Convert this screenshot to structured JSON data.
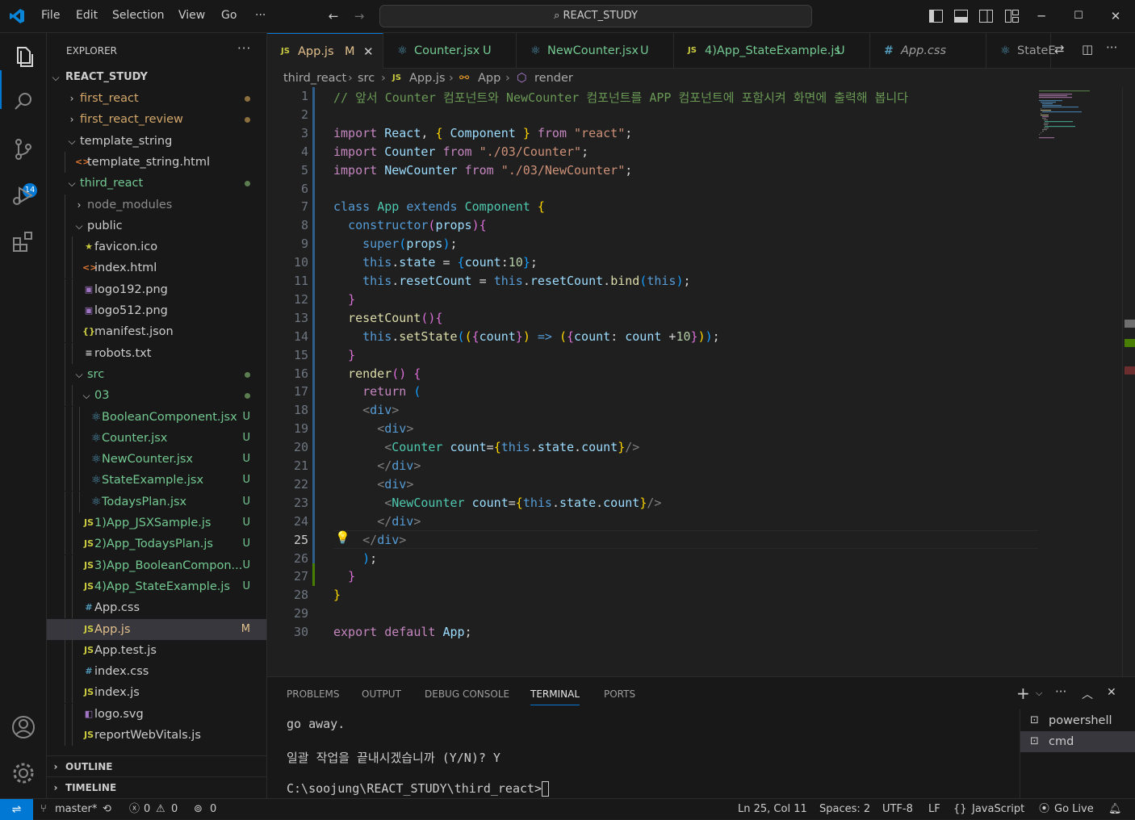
{
  "titlebar": {
    "menus": [
      "File",
      "Edit",
      "Selection",
      "View",
      "Go",
      "···"
    ],
    "search": "REACT_STUDY"
  },
  "activity": {
    "scm_badge": "14"
  },
  "explorer": {
    "title": "EXPLORER",
    "root": "REACT_STUDY",
    "items": [
      {
        "label": "first_react",
        "type": "folder",
        "open": false,
        "indent": 1,
        "color": "#d4a86a",
        "mark": "dot"
      },
      {
        "label": "first_react_review",
        "type": "folder",
        "open": false,
        "indent": 1,
        "color": "#d4a86a",
        "mark": "dot"
      },
      {
        "label": "template_string",
        "type": "folder",
        "open": true,
        "indent": 1,
        "color": "#cccccc",
        "mark": ""
      },
      {
        "label": "template_string.html",
        "type": "html",
        "indent": 2,
        "color": "#cccccc",
        "mark": ""
      },
      {
        "label": "third_react",
        "type": "folder",
        "open": true,
        "indent": 1,
        "color": "#73c991",
        "mark": "dotg"
      },
      {
        "label": "node_modules",
        "type": "folder",
        "open": false,
        "indent": 2,
        "color": "#8c8c8c",
        "mark": ""
      },
      {
        "label": "public",
        "type": "folder",
        "open": true,
        "indent": 2,
        "color": "#cccccc",
        "mark": ""
      },
      {
        "label": "favicon.ico",
        "type": "star",
        "indent": 3,
        "color": "#cccccc",
        "mark": ""
      },
      {
        "label": "index.html",
        "type": "html",
        "indent": 3,
        "color": "#cccccc",
        "mark": ""
      },
      {
        "label": "logo192.png",
        "type": "img",
        "indent": 3,
        "color": "#cccccc",
        "mark": ""
      },
      {
        "label": "logo512.png",
        "type": "img",
        "indent": 3,
        "color": "#cccccc",
        "mark": ""
      },
      {
        "label": "manifest.json",
        "type": "json",
        "indent": 3,
        "color": "#cccccc",
        "mark": ""
      },
      {
        "label": "robots.txt",
        "type": "txt",
        "indent": 3,
        "color": "#cccccc",
        "mark": ""
      },
      {
        "label": "src",
        "type": "folder",
        "open": true,
        "indent": 2,
        "color": "#73c991",
        "mark": "dotg"
      },
      {
        "label": "03",
        "type": "folder",
        "open": true,
        "indent": 3,
        "color": "#73c991",
        "mark": "dotg"
      },
      {
        "label": "BooleanComponent.jsx",
        "type": "react",
        "indent": 4,
        "color": "#73c991",
        "mark": "U"
      },
      {
        "label": "Counter.jsx",
        "type": "react",
        "indent": 4,
        "color": "#73c991",
        "mark": "U"
      },
      {
        "label": "NewCounter.jsx",
        "type": "react",
        "indent": 4,
        "color": "#73c991",
        "mark": "U"
      },
      {
        "label": "StateExample.jsx",
        "type": "react",
        "indent": 4,
        "color": "#73c991",
        "mark": "U"
      },
      {
        "label": "TodaysPlan.jsx",
        "type": "react",
        "indent": 4,
        "color": "#73c991",
        "mark": "U"
      },
      {
        "label": "1)App_JSXSample.js",
        "type": "js",
        "indent": 3,
        "color": "#73c991",
        "mark": "U"
      },
      {
        "label": "2)App_TodaysPlan.js",
        "type": "js",
        "indent": 3,
        "color": "#73c991",
        "mark": "U"
      },
      {
        "label": "3)App_BooleanCompon...",
        "type": "js",
        "indent": 3,
        "color": "#73c991",
        "mark": "U"
      },
      {
        "label": "4)App_StateExample.js",
        "type": "js",
        "indent": 3,
        "color": "#73c991",
        "mark": "U"
      },
      {
        "label": "App.css",
        "type": "css",
        "indent": 3,
        "color": "#cccccc",
        "mark": ""
      },
      {
        "label": "App.js",
        "type": "js",
        "indent": 3,
        "color": "#e2c08d",
        "mark": "M",
        "selected": true
      },
      {
        "label": "App.test.js",
        "type": "js",
        "indent": 3,
        "color": "#cccccc",
        "mark": ""
      },
      {
        "label": "index.css",
        "type": "css",
        "indent": 3,
        "color": "#cccccc",
        "mark": ""
      },
      {
        "label": "index.js",
        "type": "js",
        "indent": 3,
        "color": "#cccccc",
        "mark": ""
      },
      {
        "label": "logo.svg",
        "type": "svg",
        "indent": 3,
        "color": "#cccccc",
        "mark": ""
      },
      {
        "label": "reportWebVitals.js",
        "type": "js",
        "indent": 3,
        "color": "#cccccc",
        "mark": ""
      }
    ],
    "outline": "OUTLINE",
    "timeline": "TIMELINE"
  },
  "tabs": [
    {
      "icon": "JS",
      "label": "App.js",
      "status": "M",
      "color": "#e2c08d",
      "active": true
    },
    {
      "icon": "react",
      "label": "Counter.jsx",
      "status": "U",
      "color": "#73c991"
    },
    {
      "icon": "react",
      "label": "NewCounter.jsx",
      "status": "U",
      "color": "#73c991"
    },
    {
      "icon": "JS",
      "label": "4)App_StateExample.js",
      "status": "U",
      "color": "#73c991"
    },
    {
      "icon": "#",
      "label": "App.css",
      "status": "",
      "color": "#9d9d9d"
    },
    {
      "icon": "react",
      "label": "StateE",
      "status": "",
      "color": "#9d9d9d"
    }
  ],
  "breadcrumb": [
    "third_react",
    "src",
    "App.js",
    "App",
    "render"
  ],
  "editor": {
    "cursor_line": 25,
    "lines": [
      "<cm>// 앞서 Counter 컴포넌트와 NewCounter 컴포넌트를 APP 컴포넌트에 포함시켜 화면에 출력해 봅니다</cm>",
      "",
      "<kc>import</kc> <var>React</var>, <br1>{</br1> <var>Component</var> <br1>}</br1> <kc>from</kc> <str>\"react\"</str>;",
      "<kc>import</kc> <var>Counter</var> <kc>from</kc> <str>\"./03/Counter\"</str>;",
      "<kc>import</kc> <var>NewCounter</var> <kc>from</kc> <str>\"./03/NewCounter\"</str>;",
      "",
      "<kw>class</kw> <cls>App</cls> <kw>extends</kw> <cls>Component</cls> <br1>{</br1>",
      "  <kw>constructor</kw><br2>(</br2><var>props</var><br2>){</br2>",
      "    <kw>super</kw><br3>(</br3><var>props</var><br3>)</br3>;",
      "    <kw>this</kw>.<var>state</var> = <br3>{</br3><var>count</var>:<num>10</num><br3>}</br3>;",
      "    <kw>this</kw>.<var>resetCount</var> = <kw>this</kw>.<var>resetCount</var>.<fn>bind</fn><br3>(</br3><kw>this</kw><br3>)</br3>;",
      "  <br2>}</br2>",
      "  <fn>resetCount</fn><br2>(){</br2>",
      "    <kw>this</kw>.<fn>setState</fn><br3>(</br3><br1>(</br1><br2>{</br2><var>count</var><br2>}</br2><br1>)</br1> <kw>=></kw> <br1>(</br1><br2>{</br2><var>count</var>: <var>count</var> +<num>10</num><br2>}</br2><br1>)</br1><br3>)</br3>;",
      "  <br2>}</br2>",
      "  <fn>render</fn><br2>()</br2> <br2>{</br2>",
      "    <kc>return</kc> <br3>(</br3>",
      "    <tag>&lt;</tag><tg>div</tg><tag>&gt;</tag>",
      "      <tag>&lt;</tag><tg>div</tg><tag>&gt;</tag>",
      "       <tag>&lt;</tag><cls>Counter</cls> <var>count</var>=<br1>{</br1><kw>this</kw>.<var>state</var>.<var>count</var><br1>}</br1><tag>/&gt;</tag>",
      "      <tag>&lt;/</tag><tg>div</tg><tag>&gt;</tag>",
      "      <tag>&lt;</tag><tg>div</tg><tag>&gt;</tag>",
      "       <tag>&lt;</tag><cls>NewCounter</cls> <var>count</var>=<br1>{</br1><kw>this</kw>.<var>state</var>.<var>count</var><br1>}</br1><tag>/&gt;</tag>",
      "      <tag>&lt;/</tag><tg>div</tg><tag>&gt;</tag>",
      "    <tag>&lt;/</tag><tg>div</tg><tag>&gt;</tag>",
      "    <br3>)</br3>;",
      "  <br2>}</br2>",
      "<br1>}</br1>",
      "",
      "<kc>export</kc> <kc>default</kc> <var>App</var>;"
    ]
  },
  "panel": {
    "tabs": [
      "PROBLEMS",
      "OUTPUT",
      "DEBUG CONSOLE",
      "TERMINAL",
      "PORTS"
    ],
    "active_tab": "TERMINAL",
    "terminal_lines": [
      "go away.",
      "일괄 작업을 끝내시겠습니까 (Y/N)? Y",
      "C:\\soojung\\REACT_STUDY\\third_react>"
    ],
    "terminals": [
      {
        "label": "powershell",
        "selected": false
      },
      {
        "label": "cmd",
        "selected": true
      }
    ]
  },
  "statusbar": {
    "branch": "master*",
    "errors": "0",
    "warnings": "0",
    "ports": "0",
    "position": "Ln 25, Col 11",
    "spaces": "Spaces: 2",
    "encoding": "UTF-8",
    "eol": "LF",
    "language": "JavaScript",
    "golive": "Go Live"
  },
  "colors": {
    "accent": "#0078d4",
    "modified": "#e2c08d",
    "untracked": "#73c991"
  }
}
